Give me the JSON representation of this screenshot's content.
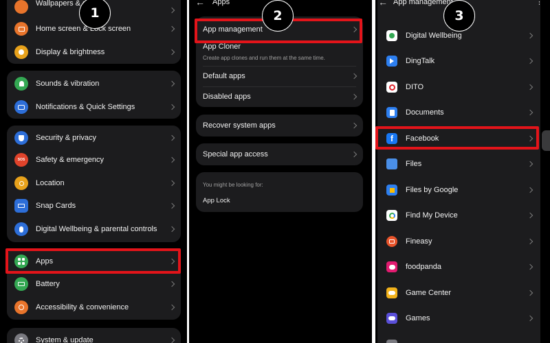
{
  "colors": {
    "background": "#000000",
    "card": "#1c1c1e",
    "highlight": "#e3141a",
    "text": "#f2f2f2",
    "subtext": "#a0a0a0"
  },
  "panel1": {
    "step": "1",
    "items": [
      {
        "label": "Wallpapers & style",
        "icon": "palette-icon"
      },
      {
        "label": "Home screen & Lock screen",
        "icon": "home-screen-icon"
      },
      {
        "label": "Display & brightness",
        "icon": "sun-icon"
      },
      {
        "label": "Sounds & vibration",
        "icon": "bell-icon"
      },
      {
        "label": "Notifications & Quick Settings",
        "icon": "notification-icon"
      },
      {
        "label": "Security & privacy",
        "icon": "shield-icon"
      },
      {
        "label": "Safety & emergency",
        "icon": "sos-icon"
      },
      {
        "label": "Location",
        "icon": "location-pin-icon"
      },
      {
        "label": "Snap Cards",
        "icon": "cards-icon"
      },
      {
        "label": "Digital Wellbeing & parental controls",
        "icon": "wellbeing-person-icon"
      },
      {
        "label": "Apps",
        "icon": "apps-grid-icon"
      },
      {
        "label": "Battery",
        "icon": "battery-icon"
      },
      {
        "label": "Accessibility & convenience",
        "icon": "accessibility-icon"
      },
      {
        "label": "System & update",
        "icon": "gear-icon"
      }
    ],
    "sos_text": "SOS"
  },
  "panel2": {
    "step": "2",
    "title": "Apps",
    "app_management": "App management",
    "app_cloner": "App Cloner",
    "app_cloner_sub": "Create app clones and run them at the same time.",
    "default_apps": "Default apps",
    "disabled_apps": "Disabled apps",
    "recover": "Recover system apps",
    "special": "Special app access",
    "looking_for": "You might be looking for:",
    "app_lock": "App Lock"
  },
  "panel3": {
    "step": "3",
    "title": "App management",
    "apps": [
      {
        "label": "Digital Wellbeing",
        "icon": "digital-wellbeing-icon"
      },
      {
        "label": "DingTalk",
        "icon": "dingtalk-icon"
      },
      {
        "label": "DITO",
        "icon": "dito-icon"
      },
      {
        "label": "Documents",
        "icon": "documents-icon"
      },
      {
        "label": "Facebook",
        "icon": "facebook-icon"
      },
      {
        "label": "Files",
        "icon": "folder-icon"
      },
      {
        "label": "Files by Google",
        "icon": "files-by-google-icon"
      },
      {
        "label": "Find My Device",
        "icon": "find-my-device-icon"
      },
      {
        "label": "Fineasy",
        "icon": "fineasy-icon"
      },
      {
        "label": "foodpanda",
        "icon": "foodpanda-icon"
      },
      {
        "label": "Game Center",
        "icon": "game-center-icon"
      },
      {
        "label": "Games",
        "icon": "games-icon"
      }
    ]
  }
}
